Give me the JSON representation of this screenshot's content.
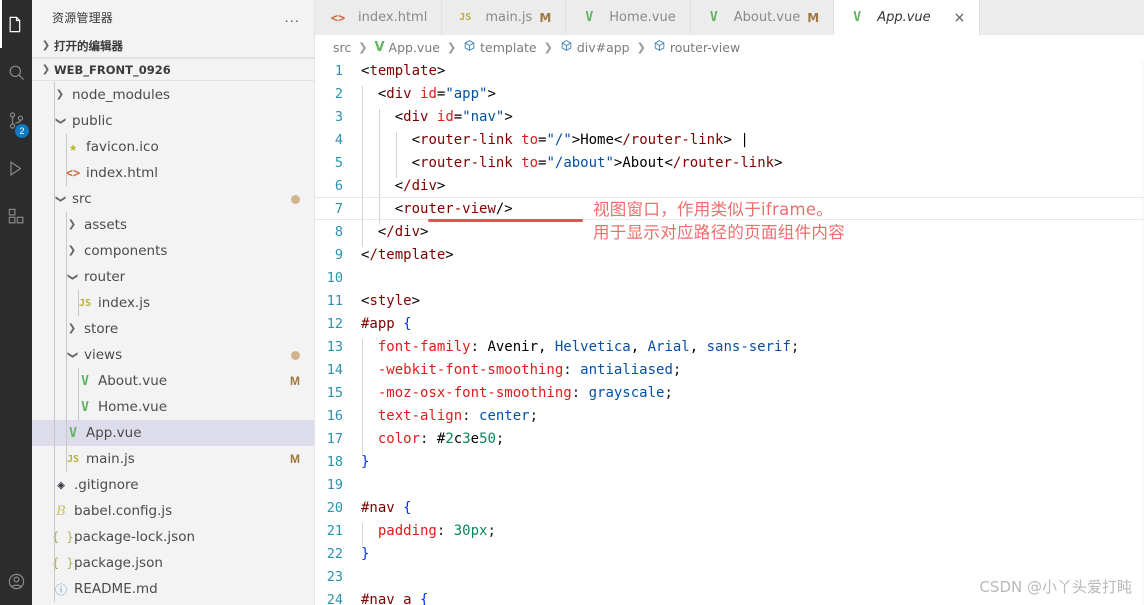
{
  "activitybar": {
    "items": [
      {
        "name": "explorer",
        "icon": "files-icon",
        "active": true,
        "badge": null
      },
      {
        "name": "search",
        "icon": "search-icon",
        "active": false,
        "badge": null
      },
      {
        "name": "source-control",
        "icon": "source-control-icon",
        "active": false,
        "badge": "2"
      },
      {
        "name": "run-and-debug",
        "icon": "run-debug-icon",
        "active": false,
        "badge": null
      },
      {
        "name": "extensions",
        "icon": "extensions-icon",
        "active": false,
        "badge": null
      },
      {
        "name": "accounts",
        "icon": "account-icon",
        "active": false,
        "badge": null
      }
    ]
  },
  "sidebar": {
    "title": "资源管理器",
    "more_actions": "...",
    "open_editors_label": "打开的编辑器",
    "project_label": "WEB_FRONT_0926",
    "tree": [
      {
        "label": "node_modules",
        "type": "folder",
        "expanded": false,
        "depth": 1,
        "icon": "chevron-right-icon",
        "mark": "",
        "dot": false
      },
      {
        "label": "public",
        "type": "folder",
        "expanded": true,
        "depth": 1,
        "icon": "chevron-down-icon",
        "mark": "",
        "dot": false
      },
      {
        "label": "favicon.ico",
        "type": "file",
        "depth": 2,
        "icon": "star-icon",
        "mark": "",
        "dot": false
      },
      {
        "label": "index.html",
        "type": "file",
        "depth": 2,
        "icon": "html-icon",
        "mark": "",
        "dot": false
      },
      {
        "label": "src",
        "type": "folder",
        "expanded": true,
        "depth": 1,
        "icon": "chevron-down-icon",
        "mark": "",
        "dot": true
      },
      {
        "label": "assets",
        "type": "folder",
        "expanded": false,
        "depth": 2,
        "icon": "chevron-right-icon",
        "mark": "",
        "dot": false
      },
      {
        "label": "components",
        "type": "folder",
        "expanded": false,
        "depth": 2,
        "icon": "chevron-right-icon",
        "mark": "",
        "dot": false
      },
      {
        "label": "router",
        "type": "folder",
        "expanded": true,
        "depth": 2,
        "icon": "chevron-down-icon",
        "mark": "",
        "dot": false
      },
      {
        "label": "index.js",
        "type": "file",
        "depth": 3,
        "icon": "js-icon",
        "mark": "",
        "dot": false
      },
      {
        "label": "store",
        "type": "folder",
        "expanded": false,
        "depth": 2,
        "icon": "chevron-right-icon",
        "mark": "",
        "dot": false
      },
      {
        "label": "views",
        "type": "folder",
        "expanded": true,
        "depth": 2,
        "icon": "chevron-down-icon",
        "mark": "",
        "dot": true
      },
      {
        "label": "About.vue",
        "type": "file",
        "depth": 3,
        "icon": "vue-icon",
        "mark": "M",
        "dot": false
      },
      {
        "label": "Home.vue",
        "type": "file",
        "depth": 3,
        "icon": "vue-icon",
        "mark": "",
        "dot": false
      },
      {
        "label": "App.vue",
        "type": "file",
        "depth": 2,
        "icon": "vue-icon",
        "mark": "",
        "dot": false,
        "selected": true
      },
      {
        "label": "main.js",
        "type": "file",
        "depth": 2,
        "icon": "js-icon",
        "mark": "M",
        "dot": false
      },
      {
        "label": ".gitignore",
        "type": "file",
        "depth": 1,
        "icon": "git-icon",
        "mark": "",
        "dot": false
      },
      {
        "label": "babel.config.js",
        "type": "file",
        "depth": 1,
        "icon": "babel-icon",
        "mark": "",
        "dot": false
      },
      {
        "label": "package-lock.json",
        "type": "file",
        "depth": 1,
        "icon": "json-icon",
        "mark": "",
        "dot": false
      },
      {
        "label": "package.json",
        "type": "file",
        "depth": 1,
        "icon": "json-icon",
        "mark": "",
        "dot": false
      },
      {
        "label": "README.md",
        "type": "file",
        "depth": 1,
        "icon": "markdown-icon",
        "mark": "",
        "dot": false
      }
    ]
  },
  "tabs": [
    {
      "label": "index.html",
      "icon": "html-icon",
      "modified": "",
      "active": false,
      "closable": false
    },
    {
      "label": "main.js",
      "icon": "js-icon",
      "modified": "M",
      "active": false,
      "closable": false
    },
    {
      "label": "Home.vue",
      "icon": "vue-icon",
      "modified": "",
      "active": false,
      "closable": false
    },
    {
      "label": "About.vue",
      "icon": "vue-icon",
      "modified": "M",
      "active": false,
      "closable": false
    },
    {
      "label": "App.vue",
      "icon": "vue-icon",
      "modified": "",
      "active": true,
      "closable": true,
      "close_label": "×"
    }
  ],
  "breadcrumb": [
    {
      "label": "src",
      "icon": ""
    },
    {
      "label": "App.vue",
      "icon": "vue-icon"
    },
    {
      "label": "template",
      "icon": "symbol-cube-icon"
    },
    {
      "label": "div#app",
      "icon": "symbol-cube-icon"
    },
    {
      "label": "router-view",
      "icon": "symbol-cube-icon"
    }
  ],
  "code": {
    "language": "vue",
    "current_line": 7,
    "color_swatch": "#2c3e50",
    "lines": [
      {
        "n": 1,
        "indent": 0,
        "text": "<template>"
      },
      {
        "n": 2,
        "indent": 1,
        "text": "  <div id=\"app\">"
      },
      {
        "n": 3,
        "indent": 2,
        "text": "    <div id=\"nav\">"
      },
      {
        "n": 4,
        "indent": 3,
        "text": "      <router-link to=\"/\">Home</router-link> |"
      },
      {
        "n": 5,
        "indent": 3,
        "text": "      <router-link to=\"/about\">About</router-link>"
      },
      {
        "n": 6,
        "indent": 2,
        "text": "    </div>"
      },
      {
        "n": 7,
        "indent": 2,
        "text": "    <router-view/>"
      },
      {
        "n": 8,
        "indent": 1,
        "text": "  </div>"
      },
      {
        "n": 9,
        "indent": 0,
        "text": "</template>"
      },
      {
        "n": 10,
        "indent": 0,
        "text": ""
      },
      {
        "n": 11,
        "indent": 0,
        "text": "<style>"
      },
      {
        "n": 12,
        "indent": 0,
        "text": "#app {"
      },
      {
        "n": 13,
        "indent": 1,
        "text": "  font-family: Avenir, Helvetica, Arial, sans-serif;"
      },
      {
        "n": 14,
        "indent": 1,
        "text": "  -webkit-font-smoothing: antialiased;"
      },
      {
        "n": 15,
        "indent": 1,
        "text": "  -moz-osx-font-smoothing: grayscale;"
      },
      {
        "n": 16,
        "indent": 1,
        "text": "  text-align: center;"
      },
      {
        "n": 17,
        "indent": 1,
        "text": "  color: #2c3e50;"
      },
      {
        "n": 18,
        "indent": 0,
        "text": "}"
      },
      {
        "n": 19,
        "indent": 0,
        "text": ""
      },
      {
        "n": 20,
        "indent": 0,
        "text": "#nav {"
      },
      {
        "n": 21,
        "indent": 1,
        "text": "  padding: 30px;"
      },
      {
        "n": 22,
        "indent": 0,
        "text": "}"
      },
      {
        "n": 23,
        "indent": 0,
        "text": ""
      },
      {
        "n": 24,
        "indent": 0,
        "text": "#nav a {"
      }
    ]
  },
  "annotations": {
    "line1": "视图窗口，作用类似于iframe。",
    "line2": "用于显示对应路径的页面组件内容"
  },
  "watermark": "CSDN @小丫头爱打盹",
  "colors": {
    "accent_blue": "#0e7ac4",
    "annotation_red": "#ee6d6d",
    "underline_red": "#e8504f",
    "modified_marker": "#a07840",
    "selection": "#dcdcea"
  }
}
